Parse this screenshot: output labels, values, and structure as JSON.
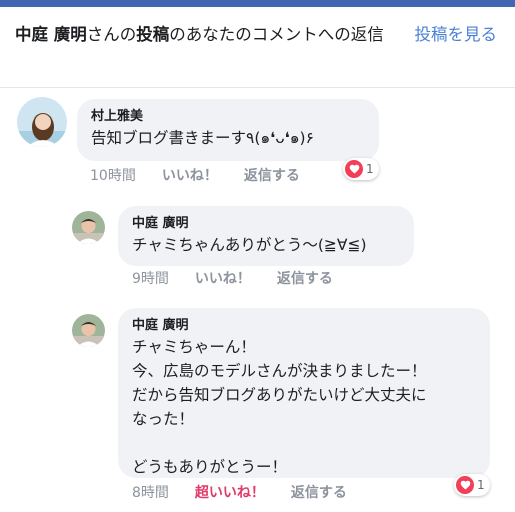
{
  "header": {
    "notice_name": "中庭 廣明",
    "notice_mid": "さんの",
    "notice_post": "投稿",
    "notice_tail": "のあなたのコメントへの返信",
    "view_post_label": "投稿を見る"
  },
  "comments": [
    {
      "author": "村上雅美",
      "text": "告知ブログ書きまーす٩(๑❛ᴗ❛๑)۶",
      "time": "10時間",
      "like_label": "いいね！",
      "reply_label": "返信する",
      "reaction_count": "1"
    },
    {
      "author": "中庭 廣明",
      "text": "チャミちゃんありがとう〜(≧∀≦)",
      "time": "9時間",
      "like_label": "いいね！",
      "reply_label": "返信する"
    },
    {
      "author": "中庭 廣明",
      "text": "チャミちゃーん！\n今、広島のモデルさんが決まりましたー！\nだから告知ブログありがたいけど大丈夫に\nなった！\n\nどうもありがとうー！",
      "time": "8時間",
      "like_label": "超いいね！",
      "reply_label": "返信する",
      "reaction_count": "1"
    }
  ],
  "colors": {
    "accent": "#4a7fd6",
    "reaction_heart": "#f33e58",
    "super_like": "#e0396a"
  }
}
